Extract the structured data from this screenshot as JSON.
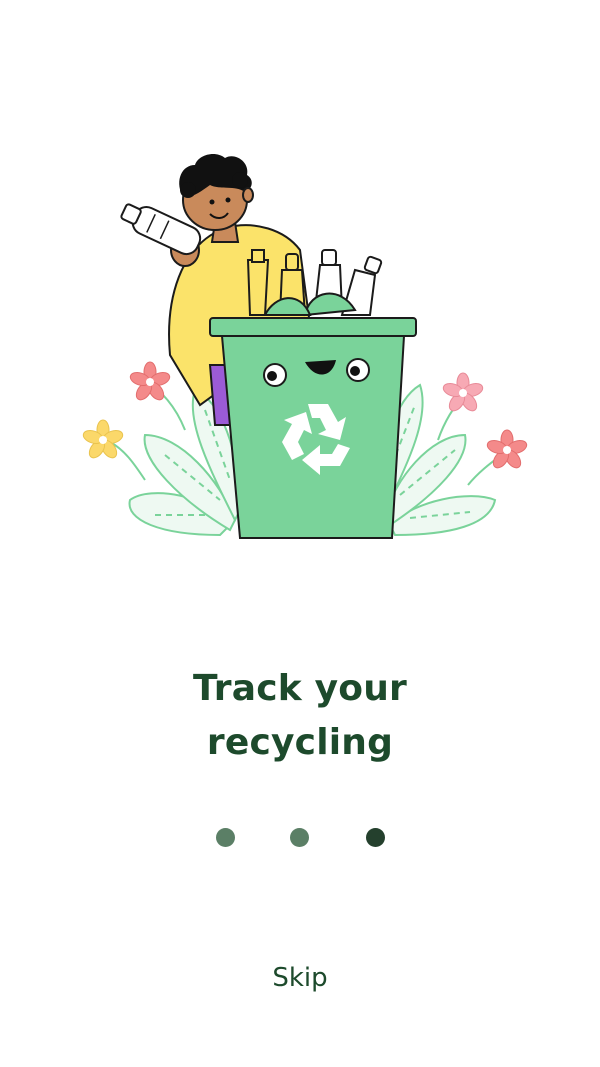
{
  "onboarding": {
    "title_line1": "Track your",
    "title_line2": "recycling",
    "skip_label": "Skip",
    "page_count": 3,
    "active_page_index": 2
  },
  "colors": {
    "title": "#1d4a2c",
    "dot_inactive": "#5b7f66",
    "dot_active": "#24402d",
    "bin": "#7ad39a",
    "shirt": "#fbe36a",
    "skin": "#c98a5b"
  },
  "illustration": {
    "name": "recycling-bin-with-person",
    "icon": "recycle-icon"
  }
}
